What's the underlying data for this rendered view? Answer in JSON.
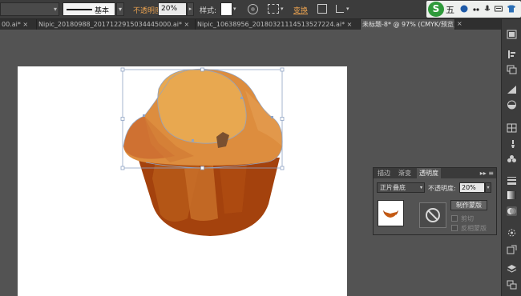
{
  "control_bar": {
    "stroke_style_label": "基本",
    "opacity_label": "不透明度:",
    "opacity_value": "20%",
    "style_label": "样式:",
    "transform_label": "变换"
  },
  "ime": {
    "logo": "S",
    "mode": "五"
  },
  "tabs": [
    {
      "label": "00.ai* ×",
      "active": false
    },
    {
      "label": "Nipic_20180988_20171229150344450​00.ai* ×",
      "active": false
    },
    {
      "label": "Nipic_10638956_20180321114513527224.ai* ×",
      "active": false
    },
    {
      "label": "未标题-8* @ 97% (CMYK/预览)",
      "active": true
    }
  ],
  "transparency_panel": {
    "tabs": [
      "描边",
      "渐变",
      "透明度"
    ],
    "active_tab": "透明度",
    "blend_mode": "正片叠底",
    "opacity_label": "不透明度:",
    "opacity_value": "20%",
    "make_mask_label": "制作蒙版",
    "clip_label": "剪切",
    "invert_mask_label": "反相蒙版"
  },
  "colors": {
    "top_light": "#e8a850",
    "top_mid": "#dd8d3e",
    "top_dark": "#cf7132",
    "cup_dark": "#a4420d",
    "cup_mid": "#b85a18",
    "chip": "#7a5030",
    "selection": "#8fa3c4"
  }
}
